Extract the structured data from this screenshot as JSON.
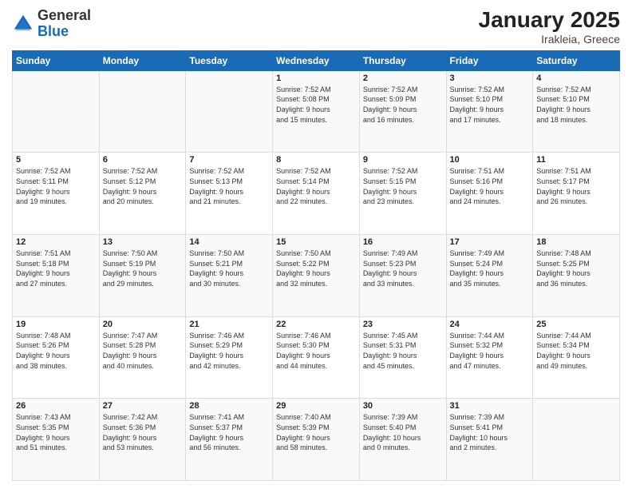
{
  "header": {
    "logo_general": "General",
    "logo_blue": "Blue",
    "title": "January 2025",
    "subtitle": "Irakleia, Greece"
  },
  "calendar": {
    "days_of_week": [
      "Sunday",
      "Monday",
      "Tuesday",
      "Wednesday",
      "Thursday",
      "Friday",
      "Saturday"
    ],
    "weeks": [
      [
        {
          "day": "",
          "info": ""
        },
        {
          "day": "",
          "info": ""
        },
        {
          "day": "",
          "info": ""
        },
        {
          "day": "1",
          "info": "Sunrise: 7:52 AM\nSunset: 5:08 PM\nDaylight: 9 hours\nand 15 minutes."
        },
        {
          "day": "2",
          "info": "Sunrise: 7:52 AM\nSunset: 5:09 PM\nDaylight: 9 hours\nand 16 minutes."
        },
        {
          "day": "3",
          "info": "Sunrise: 7:52 AM\nSunset: 5:10 PM\nDaylight: 9 hours\nand 17 minutes."
        },
        {
          "day": "4",
          "info": "Sunrise: 7:52 AM\nSunset: 5:10 PM\nDaylight: 9 hours\nand 18 minutes."
        }
      ],
      [
        {
          "day": "5",
          "info": "Sunrise: 7:52 AM\nSunset: 5:11 PM\nDaylight: 9 hours\nand 19 minutes."
        },
        {
          "day": "6",
          "info": "Sunrise: 7:52 AM\nSunset: 5:12 PM\nDaylight: 9 hours\nand 20 minutes."
        },
        {
          "day": "7",
          "info": "Sunrise: 7:52 AM\nSunset: 5:13 PM\nDaylight: 9 hours\nand 21 minutes."
        },
        {
          "day": "8",
          "info": "Sunrise: 7:52 AM\nSunset: 5:14 PM\nDaylight: 9 hours\nand 22 minutes."
        },
        {
          "day": "9",
          "info": "Sunrise: 7:52 AM\nSunset: 5:15 PM\nDaylight: 9 hours\nand 23 minutes."
        },
        {
          "day": "10",
          "info": "Sunrise: 7:51 AM\nSunset: 5:16 PM\nDaylight: 9 hours\nand 24 minutes."
        },
        {
          "day": "11",
          "info": "Sunrise: 7:51 AM\nSunset: 5:17 PM\nDaylight: 9 hours\nand 26 minutes."
        }
      ],
      [
        {
          "day": "12",
          "info": "Sunrise: 7:51 AM\nSunset: 5:18 PM\nDaylight: 9 hours\nand 27 minutes."
        },
        {
          "day": "13",
          "info": "Sunrise: 7:50 AM\nSunset: 5:19 PM\nDaylight: 9 hours\nand 29 minutes."
        },
        {
          "day": "14",
          "info": "Sunrise: 7:50 AM\nSunset: 5:21 PM\nDaylight: 9 hours\nand 30 minutes."
        },
        {
          "day": "15",
          "info": "Sunrise: 7:50 AM\nSunset: 5:22 PM\nDaylight: 9 hours\nand 32 minutes."
        },
        {
          "day": "16",
          "info": "Sunrise: 7:49 AM\nSunset: 5:23 PM\nDaylight: 9 hours\nand 33 minutes."
        },
        {
          "day": "17",
          "info": "Sunrise: 7:49 AM\nSunset: 5:24 PM\nDaylight: 9 hours\nand 35 minutes."
        },
        {
          "day": "18",
          "info": "Sunrise: 7:48 AM\nSunset: 5:25 PM\nDaylight: 9 hours\nand 36 minutes."
        }
      ],
      [
        {
          "day": "19",
          "info": "Sunrise: 7:48 AM\nSunset: 5:26 PM\nDaylight: 9 hours\nand 38 minutes."
        },
        {
          "day": "20",
          "info": "Sunrise: 7:47 AM\nSunset: 5:28 PM\nDaylight: 9 hours\nand 40 minutes."
        },
        {
          "day": "21",
          "info": "Sunrise: 7:46 AM\nSunset: 5:29 PM\nDaylight: 9 hours\nand 42 minutes."
        },
        {
          "day": "22",
          "info": "Sunrise: 7:46 AM\nSunset: 5:30 PM\nDaylight: 9 hours\nand 44 minutes."
        },
        {
          "day": "23",
          "info": "Sunrise: 7:45 AM\nSunset: 5:31 PM\nDaylight: 9 hours\nand 45 minutes."
        },
        {
          "day": "24",
          "info": "Sunrise: 7:44 AM\nSunset: 5:32 PM\nDaylight: 9 hours\nand 47 minutes."
        },
        {
          "day": "25",
          "info": "Sunrise: 7:44 AM\nSunset: 5:34 PM\nDaylight: 9 hours\nand 49 minutes."
        }
      ],
      [
        {
          "day": "26",
          "info": "Sunrise: 7:43 AM\nSunset: 5:35 PM\nDaylight: 9 hours\nand 51 minutes."
        },
        {
          "day": "27",
          "info": "Sunrise: 7:42 AM\nSunset: 5:36 PM\nDaylight: 9 hours\nand 53 minutes."
        },
        {
          "day": "28",
          "info": "Sunrise: 7:41 AM\nSunset: 5:37 PM\nDaylight: 9 hours\nand 56 minutes."
        },
        {
          "day": "29",
          "info": "Sunrise: 7:40 AM\nSunset: 5:39 PM\nDaylight: 9 hours\nand 58 minutes."
        },
        {
          "day": "30",
          "info": "Sunrise: 7:39 AM\nSunset: 5:40 PM\nDaylight: 10 hours\nand 0 minutes."
        },
        {
          "day": "31",
          "info": "Sunrise: 7:39 AM\nSunset: 5:41 PM\nDaylight: 10 hours\nand 2 minutes."
        },
        {
          "day": "",
          "info": ""
        }
      ]
    ]
  }
}
